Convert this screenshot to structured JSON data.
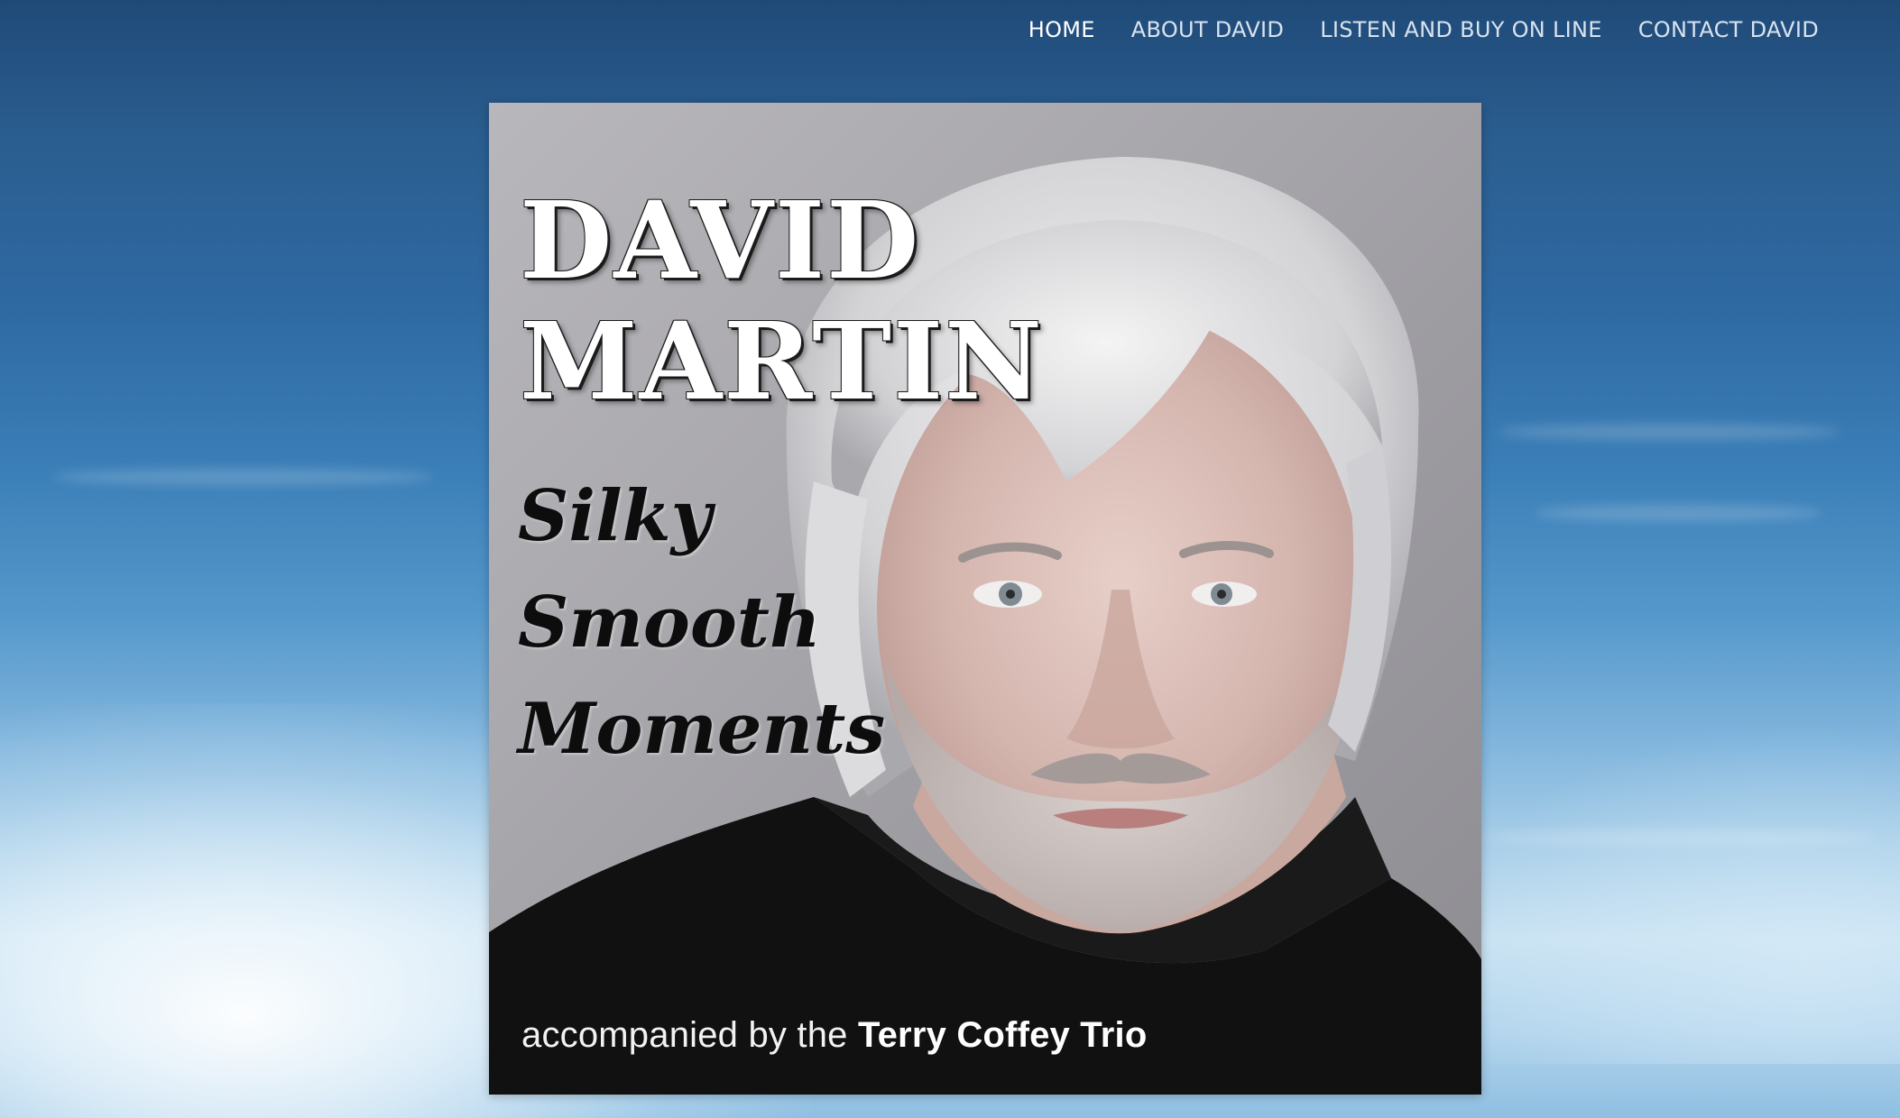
{
  "nav": {
    "items": [
      {
        "label": "HOME",
        "active": true
      },
      {
        "label": "ABOUT DAVID",
        "active": false
      },
      {
        "label": "LISTEN AND BUY ON LINE",
        "active": false
      },
      {
        "label": "CONTACT DAVID",
        "active": false
      }
    ]
  },
  "album": {
    "artist_line1": "DAVID",
    "artist_line2": "MARTIN",
    "title_line1": "Silky",
    "title_line2": "Smooth",
    "title_line3": "Moments",
    "credit_prefix": "accompanied by  the",
    "credit_group": "Terry  Coffey Trio"
  },
  "colors": {
    "nav_text": "#d9e3ee",
    "nav_active": "#ffffff",
    "sky_top": "#1f4a78",
    "sky_bottom": "#c9e2f2"
  }
}
